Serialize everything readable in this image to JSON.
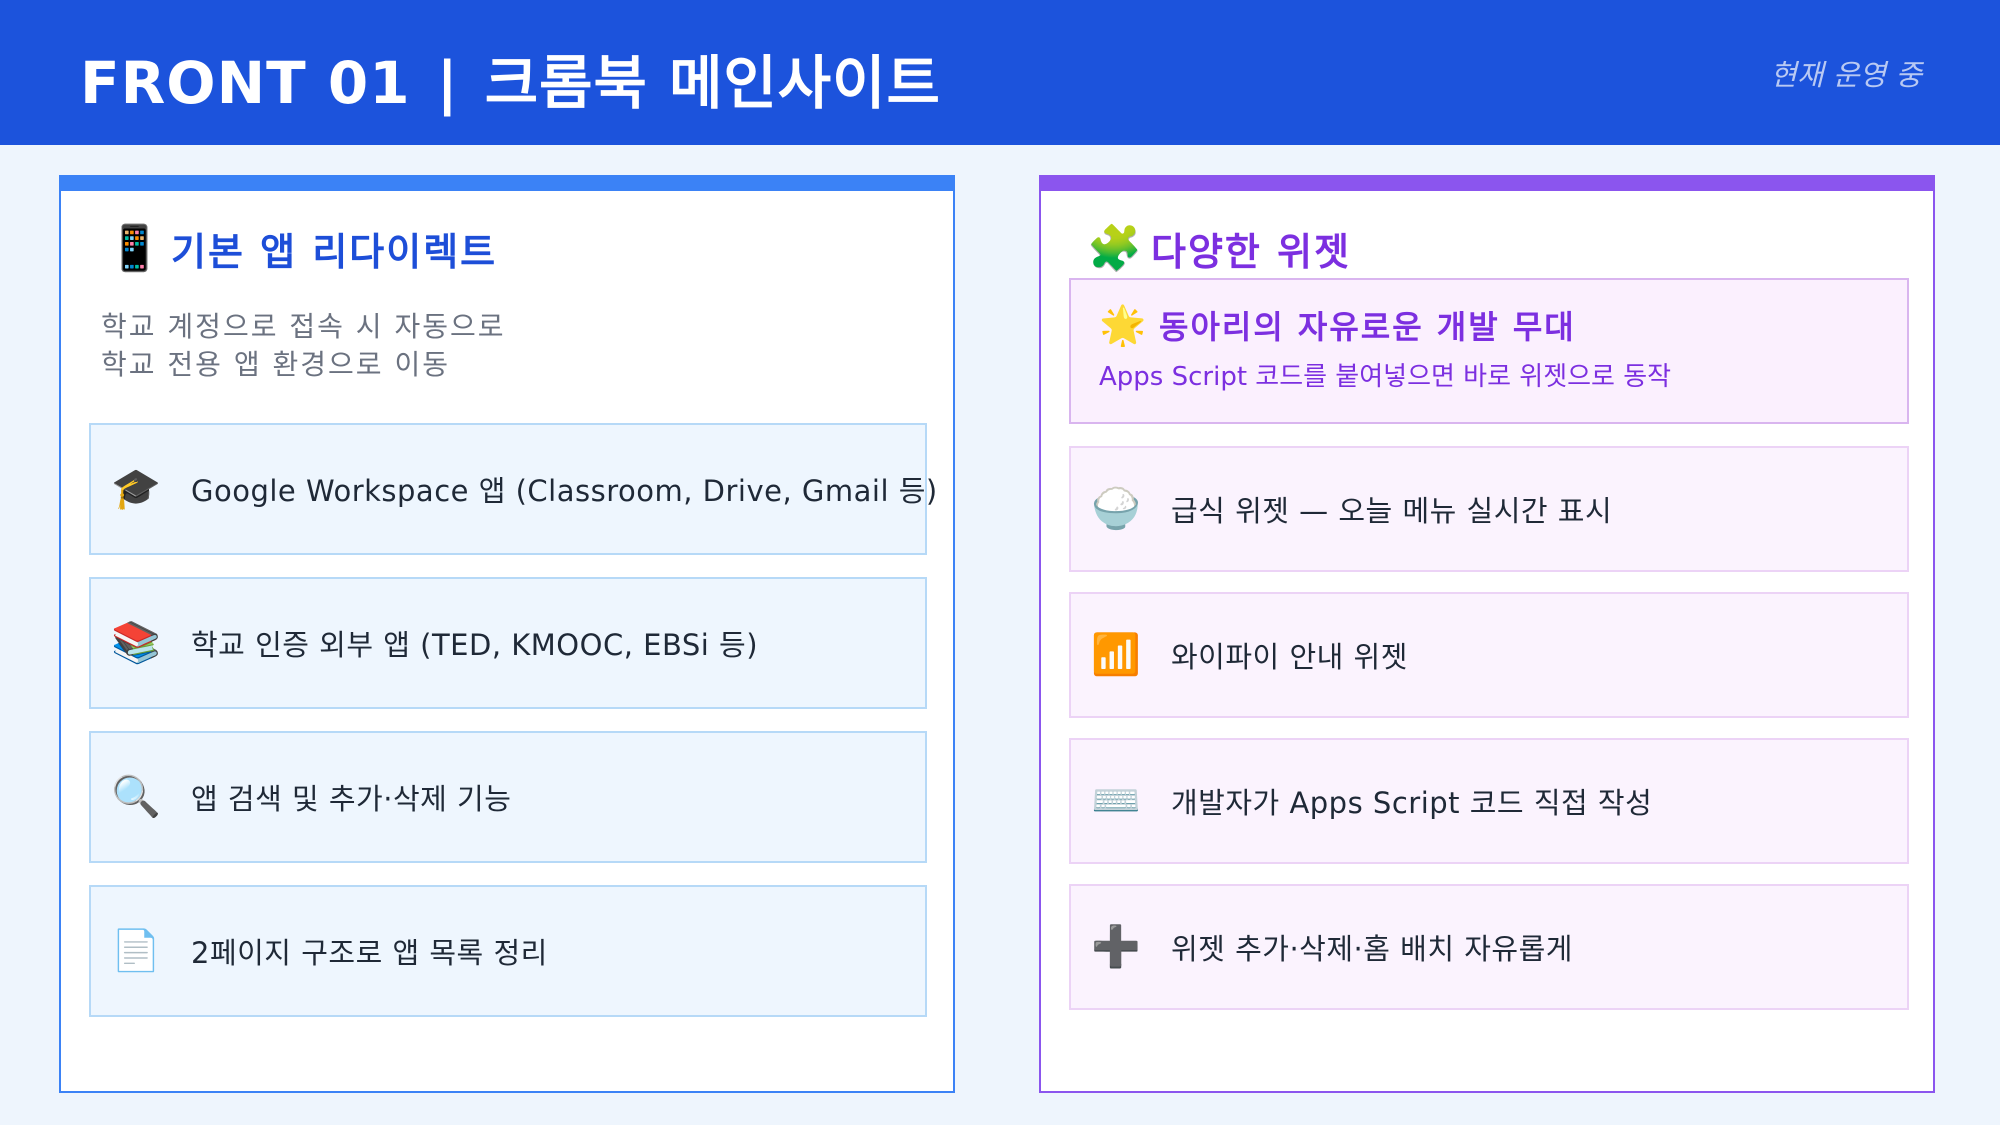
{
  "header": {
    "title_part1": "FRONT 01",
    "separator": "|",
    "title_part2": "크롬북 메인사이트",
    "status": "현재 운영 중",
    "bg_color": "#1c53dc"
  },
  "left_panel": {
    "icon": "📱",
    "icon_name": "mobile-phone-icon",
    "title": "기본 앱 리다이렉트",
    "accent_color": "#3b82f6",
    "description_line1": "학교 계정으로 접속 시 자동으로",
    "description_line2": "학교 전용 앱 환경으로 이동",
    "items": [
      {
        "icon": "🎓",
        "icon_name": "graduation-cap-icon",
        "text": "Google Workspace 앱 (Classroom, Drive, Gmail 등)"
      },
      {
        "icon": "📚",
        "icon_name": "books-icon",
        "text": "학교 인증 외부 앱 (TED, KMOOC, EBSi 등)"
      },
      {
        "icon": "🔍",
        "icon_name": "magnifier-icon",
        "text": "앱 검색 및 추가·삭제 기능"
      },
      {
        "icon": "📄",
        "icon_name": "document-icon",
        "text": "2페이지 구조로 앱 목록 정리"
      }
    ]
  },
  "right_panel": {
    "icon": "🧩",
    "icon_name": "puzzle-piece-icon",
    "title": "다양한 위젯",
    "accent_color": "#8b55ee",
    "featured": {
      "icon": "🌟",
      "icon_name": "glowing-star-icon",
      "title": "동아리의 자유로운 개발 무대",
      "description": "Apps Script 코드를 붙여넣으면 바로 위젯으로 동작"
    },
    "items": [
      {
        "icon": "🍚",
        "icon_name": "rice-bowl-icon",
        "text": "급식 위젯 — 오늘 메뉴 실시간 표시"
      },
      {
        "icon": "📶",
        "icon_name": "signal-bars-icon",
        "text": "와이파이 안내 위젯"
      },
      {
        "icon": "⌨️",
        "icon_name": "keyboard-icon",
        "text": "개발자가 Apps Script 코드 직접 작성"
      },
      {
        "icon": "➕",
        "icon_name": "plus-icon",
        "text": "위젯 추가·삭제·홈 배치 자유롭게"
      }
    ]
  }
}
